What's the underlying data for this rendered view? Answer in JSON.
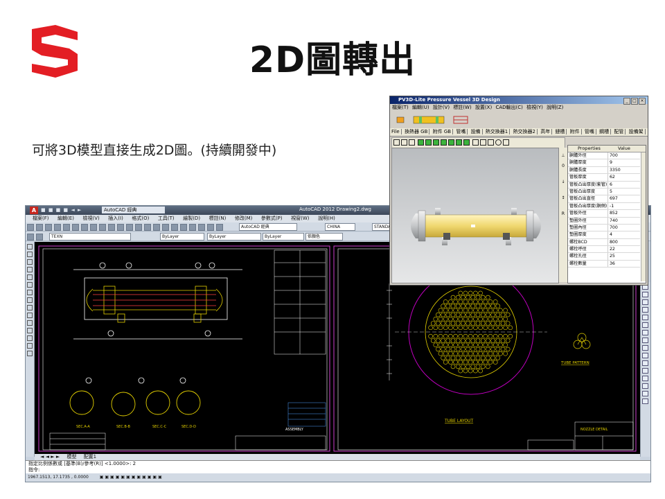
{
  "slide": {
    "title": "2D圖轉出",
    "description": "可將3D模型直接生成2D圖。(持續開發中)"
  },
  "colors": {
    "logo_red": "#e31e24",
    "cad_background": "#000000",
    "cad_yellow": "#e6d200",
    "cad_magenta": "#c000c0"
  },
  "pv3d": {
    "window_title": "PV3D-Lite Pressure Vessel 3D Design",
    "menu": [
      "檔案(T)",
      "編輯(U)",
      "設計(V)",
      "標註(W)",
      "設置(X)",
      "CAD輸出(C)",
      "檢視(Y)",
      "說明(Z)"
    ],
    "tabs": [
      "File",
      "換熱器 GB",
      "附件 GB",
      "管嘴",
      "設備",
      "熱交換器1",
      "熱交換器2",
      "高年",
      "鏈槽",
      "附件",
      "管嘴",
      "鋼槽",
      "配管",
      "設備架"
    ],
    "properties_header": {
      "name": "Properties",
      "value": "Value"
    },
    "properties": [
      {
        "name": "胴體外徑",
        "value": "700"
      },
      {
        "name": "胴體厚度",
        "value": "9"
      },
      {
        "name": "胴體長度",
        "value": "3350"
      },
      {
        "name": "管板厚度",
        "value": "62"
      },
      {
        "name": "管板凸出厚度(套管)",
        "value": "6"
      },
      {
        "name": "管板凸出厚度",
        "value": "5"
      },
      {
        "name": "管板凸出直徑",
        "value": "697"
      },
      {
        "name": "管板凸出厚度(胴側)",
        "value": "-1"
      },
      {
        "name": "管板外徑",
        "value": "852"
      },
      {
        "name": "墊圈外徑",
        "value": "740"
      },
      {
        "name": "墊圈內徑",
        "value": "700"
      },
      {
        "name": "墊圈厚度",
        "value": "4"
      },
      {
        "name": "螺栓BCD",
        "value": "800"
      },
      {
        "name": "螺栓呼徑",
        "value": "22"
      },
      {
        "name": "螺栓孔徑",
        "value": "25"
      },
      {
        "name": "螺栓數量",
        "value": "36"
      }
    ]
  },
  "autocad": {
    "window_title": "AutoCAD 2012    Drawing2.dwg",
    "workspace": "AutoCAD 經典",
    "menu": [
      "檔案(F)",
      "編輯(E)",
      "檢視(V)",
      "插入(I)",
      "格式(O)",
      "工具(T)",
      "繪製(D)",
      "標註(N)",
      "修改(M)",
      "參數式(P)",
      "視窗(W)",
      "說明(H)"
    ],
    "style_combo": "AutoCAD 經典",
    "text_style": "CHINA",
    "dim_style": "STANDA",
    "layer_combo": "TEXN",
    "color_combo": "ByLayer",
    "linetype_combo": "ByLayer",
    "lineweight_combo": "ByLayer",
    "plot_combo": "依顏色",
    "layout_tabs": [
      "模型",
      "配置1"
    ],
    "command_line_1": "指定比例係數或 [基準(B)/參考(R)] <1.0000>: 2",
    "command_line_2": "指令:",
    "coordinates": "1967.1513, 17.1735 , 0.0000",
    "drawing": {
      "tube_pattern_label": "TUBE PATTERN",
      "tube_layout_label": "TUBE LAYOUT",
      "nozzle_detail_label": "NOZZLE DETAIL",
      "assembly_label": "ASSEMBLY"
    }
  }
}
